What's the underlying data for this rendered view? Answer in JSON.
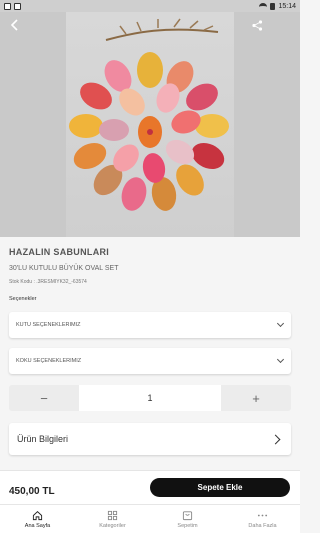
{
  "status_bar": {
    "time": "15:14"
  },
  "product": {
    "brand": "HAZALIN SABUNLARI",
    "subtitle": "30'LU KUTULU BÜYÜK OVAL SET",
    "sku": "Stok Kodu : .3RESMIYK32_-63574"
  },
  "options": {
    "label": "Seçenekler",
    "box_placeholder": "KUTU SEÇENEKLERIMIZ",
    "scent_placeholder": "KOKU SEÇENEKLERIMIZ"
  },
  "quantity": {
    "minus": "−",
    "value": "1",
    "plus": "+"
  },
  "details": {
    "label": "Ürün Bilgileri"
  },
  "buybar": {
    "price": "450,00 TL",
    "add_to_cart": "Sepete Ekle"
  },
  "nav": [
    {
      "label": "Ana Sayfa",
      "icon": "home-icon"
    },
    {
      "label": "Kategoriler",
      "icon": "grid-icon"
    },
    {
      "label": "Sepetim",
      "icon": "bag-icon"
    },
    {
      "label": "Daha Fazla",
      "icon": "more-icon"
    }
  ],
  "colors": {
    "accent": "#111111",
    "background": "#f5f5f5"
  }
}
